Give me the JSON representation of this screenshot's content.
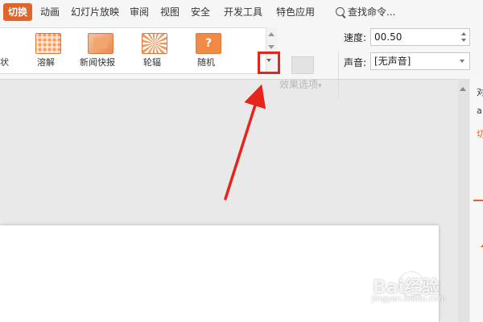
{
  "menu": {
    "items": [
      {
        "label": "切换"
      },
      {
        "label": "动画"
      },
      {
        "label": "幻灯片放映"
      },
      {
        "label": "审阅"
      },
      {
        "label": "视图"
      },
      {
        "label": "安全"
      },
      {
        "label": "开发工具"
      },
      {
        "label": "特色应用"
      }
    ],
    "search_label": "查找命令..."
  },
  "gallery": {
    "partial_label": "状",
    "items": [
      {
        "label": "溶解",
        "icon": "dissolve-icon"
      },
      {
        "label": "新闻快报",
        "icon": "news-flash-icon"
      },
      {
        "label": "轮辐",
        "icon": "wheel-icon"
      },
      {
        "label": "随机",
        "icon": "random-icon",
        "glyph": "?"
      }
    ]
  },
  "effect_options": {
    "label": "效果选项",
    "arrow": "▾"
  },
  "speed": {
    "label": "速度:",
    "value": "00.50"
  },
  "sound": {
    "label": "声音:",
    "value": "[无声音]"
  },
  "side_panel": {
    "line1": "对",
    "line2": "a",
    "line3": "切"
  },
  "watermark": {
    "main": "Bai经验",
    "sub": "jingyan.baidu.com"
  },
  "colors": {
    "accent": "#e1652b",
    "highlight": "#e8231b"
  }
}
